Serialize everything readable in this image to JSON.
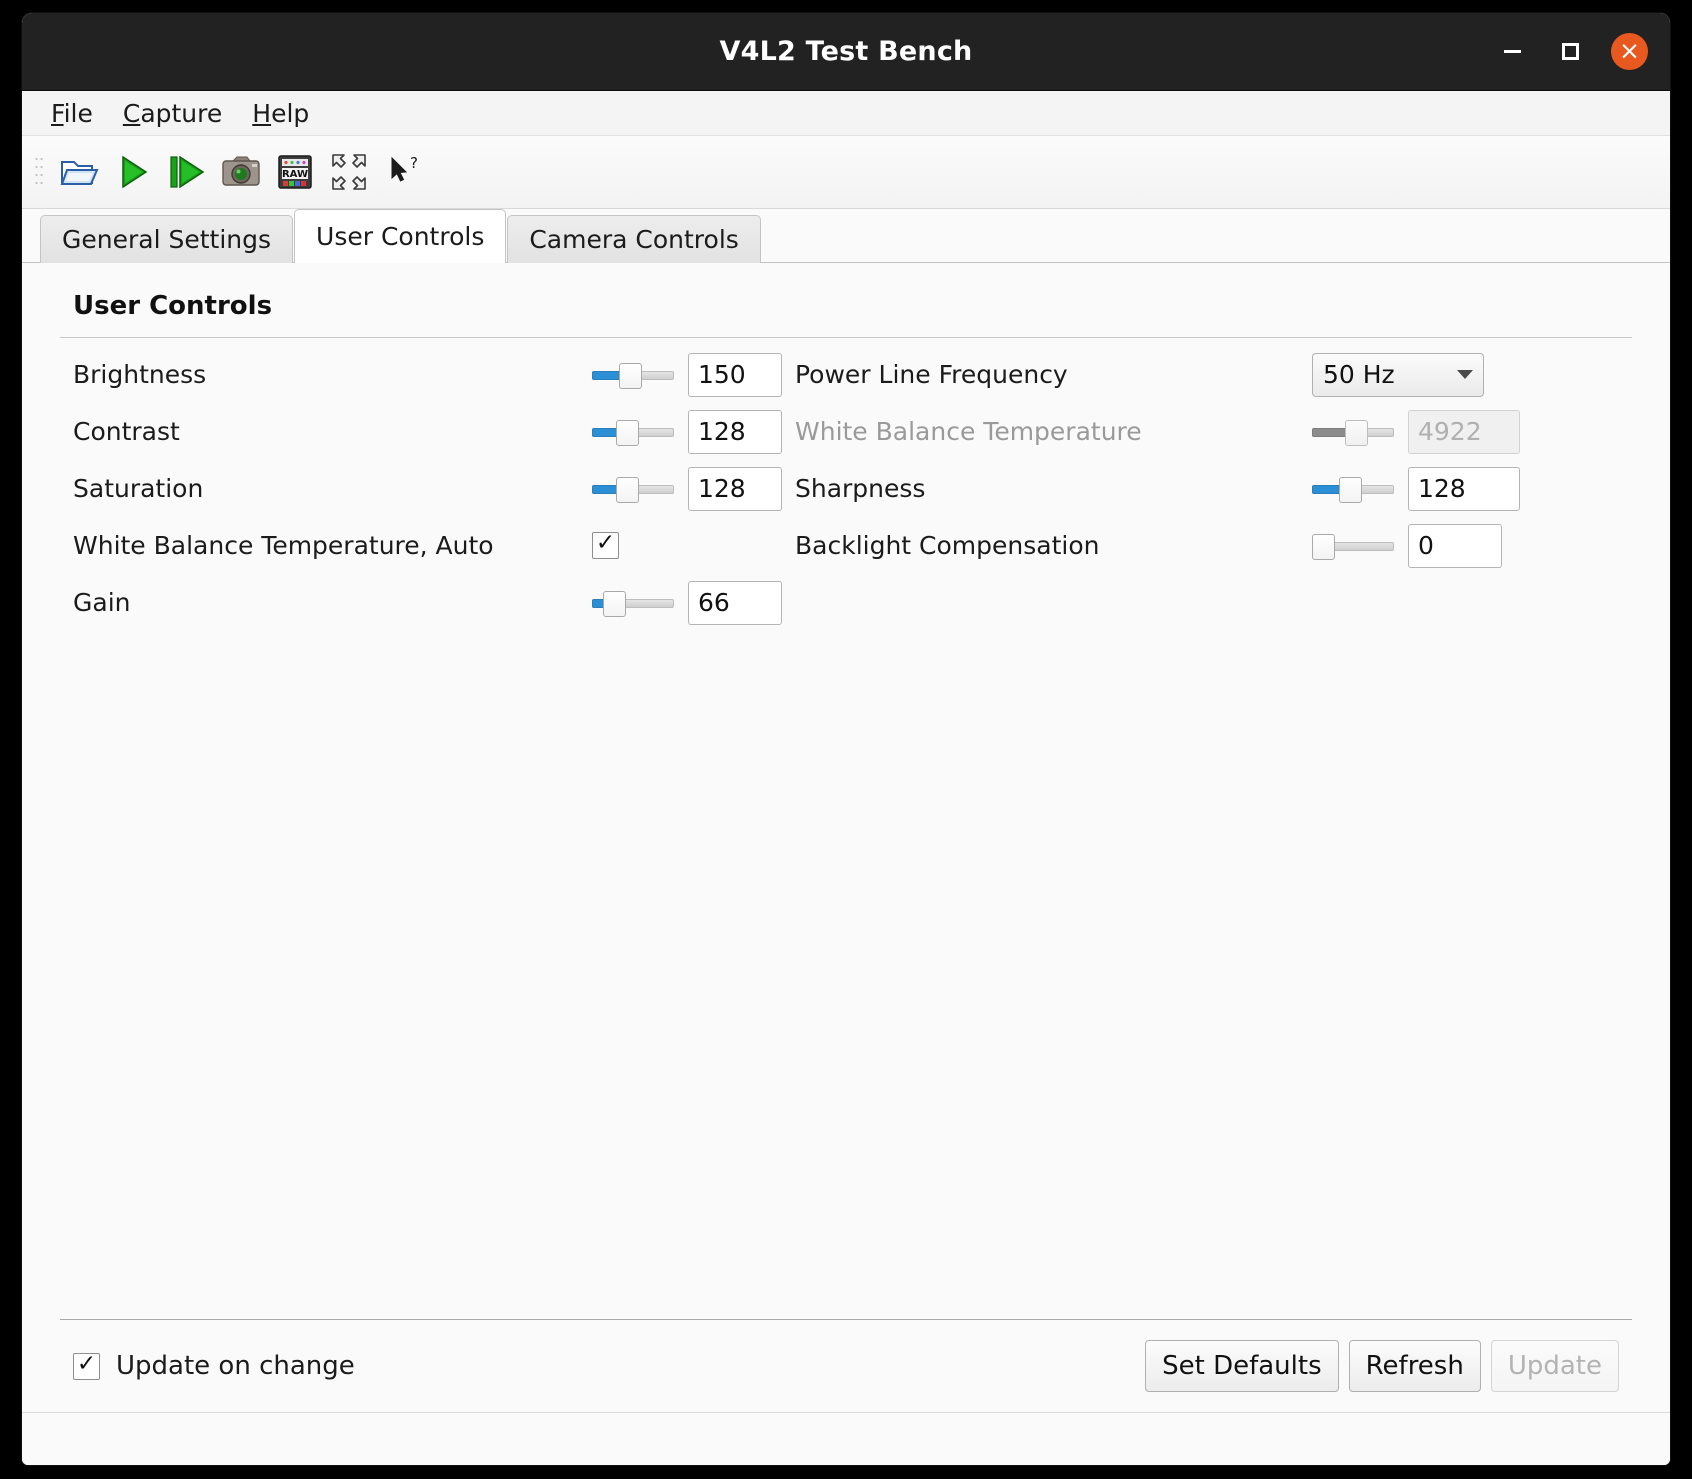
{
  "window": {
    "title": "V4L2 Test Bench",
    "buttons": {
      "minimize": "minimize-button",
      "maximize": "maximize-button",
      "close": "×"
    }
  },
  "menubar": [
    {
      "mnemonic": "F",
      "rest": "ile"
    },
    {
      "mnemonic": "C",
      "rest": "apture"
    },
    {
      "mnemonic": "H",
      "rest": "elp"
    }
  ],
  "toolbar": [
    {
      "name": "open-device-icon"
    },
    {
      "name": "play-icon"
    },
    {
      "name": "step-play-icon"
    },
    {
      "name": "snapshot-camera-icon"
    },
    {
      "name": "raw-capture-icon"
    },
    {
      "name": "fullscreen-icon"
    },
    {
      "name": "whats-this-help-icon"
    }
  ],
  "tabs": [
    {
      "label": "General Settings",
      "active": false
    },
    {
      "label": "User Controls",
      "active": true
    },
    {
      "label": "Camera Controls",
      "active": false
    }
  ],
  "panel": {
    "heading": "User Controls",
    "left_controls": [
      {
        "label": "Brightness",
        "widget": "slider",
        "value": "150",
        "fill_pct": 36,
        "handle_pct": 36,
        "disabled": false
      },
      {
        "label": "Contrast",
        "widget": "slider",
        "value": "128",
        "fill_pct": 33,
        "handle_pct": 33,
        "disabled": false
      },
      {
        "label": "Saturation",
        "widget": "slider",
        "value": "128",
        "fill_pct": 33,
        "handle_pct": 33,
        "disabled": false
      },
      {
        "label": "White Balance Temperature, Auto",
        "widget": "checkbox",
        "checked": true,
        "tick": "✓",
        "disabled": false
      },
      {
        "label": "Gain",
        "widget": "slider",
        "value": "66",
        "fill_pct": 17,
        "handle_pct": 17,
        "disabled": false
      }
    ],
    "right_controls": [
      {
        "label": "Power Line Frequency",
        "widget": "combobox",
        "value": "50 Hz",
        "disabled": false
      },
      {
        "label": "White Balance Temperature",
        "widget": "slider",
        "value": "4922",
        "fill_pct": 44,
        "handle_pct": 44,
        "disabled": true
      },
      {
        "label": "Sharpness",
        "widget": "slider",
        "value": "128",
        "fill_pct": 36,
        "handle_pct": 36,
        "disabled": false
      },
      {
        "label": "Backlight Compensation",
        "widget": "slider",
        "value": "0",
        "fill_pct": 0,
        "handle_pct": 0,
        "disabled": false
      }
    ]
  },
  "footer": {
    "update_on_change_label": "Update on change",
    "update_on_change_checked": true,
    "tick": "✓",
    "buttons": [
      {
        "label": "Set Defaults",
        "disabled": false
      },
      {
        "label": "Refresh",
        "disabled": false
      },
      {
        "label": "Update",
        "disabled": true
      }
    ]
  },
  "colors": {
    "titlebar_bg": "#222222",
    "close_button": "#e8591f",
    "slider_accent": "#2a8fd4",
    "panel_bg": "#fafafa"
  }
}
